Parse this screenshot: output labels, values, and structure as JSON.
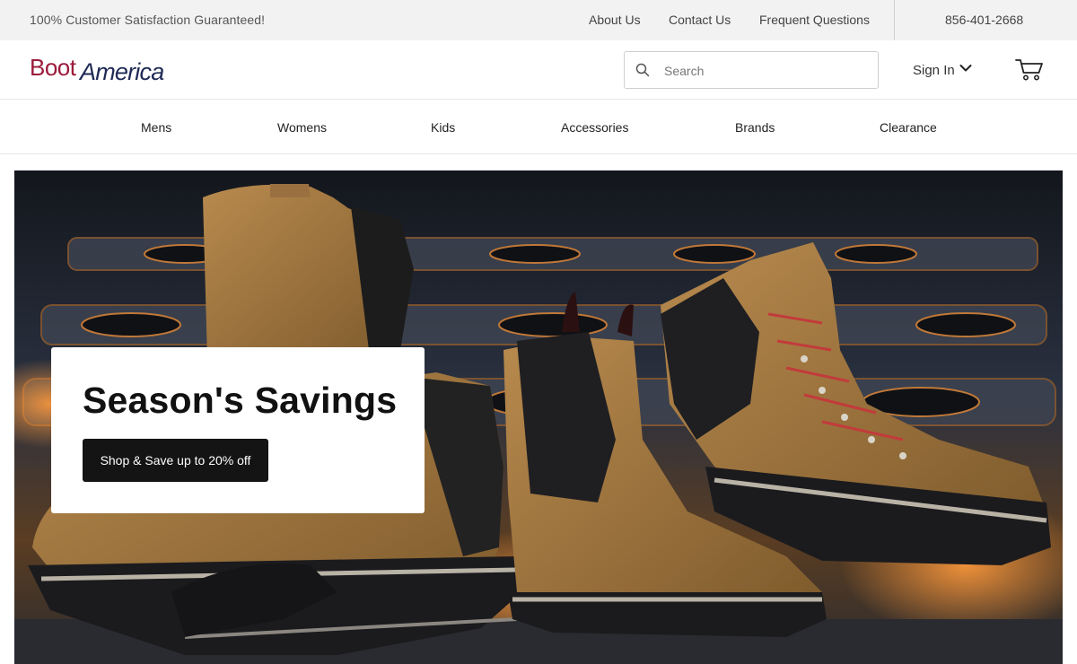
{
  "topbar": {
    "promo": "100% Customer Satisfaction Guaranteed!",
    "links": [
      "About Us",
      "Contact Us",
      "Frequent Questions"
    ],
    "phone": "856-401-2668"
  },
  "header": {
    "logo_part1": "Boot",
    "logo_part2": "America",
    "search_placeholder": "Search",
    "signin_label": "Sign In",
    "icons": [
      "search-icon",
      "chevron-down-icon",
      "cart-icon"
    ]
  },
  "categories": [
    "Mens",
    "Womens",
    "Kids",
    "Accessories",
    "Brands",
    "Clearance"
  ],
  "hero": {
    "headline": "Season's Savings",
    "cta_label": "Shop & Save up to 20% off",
    "image": "work-boots-photo"
  },
  "colors": {
    "brand_red": "#9b1b3b",
    "brand_navy": "#1f2a55",
    "topbar_bg": "#f2f2f2",
    "cta_bg": "#141414"
  }
}
